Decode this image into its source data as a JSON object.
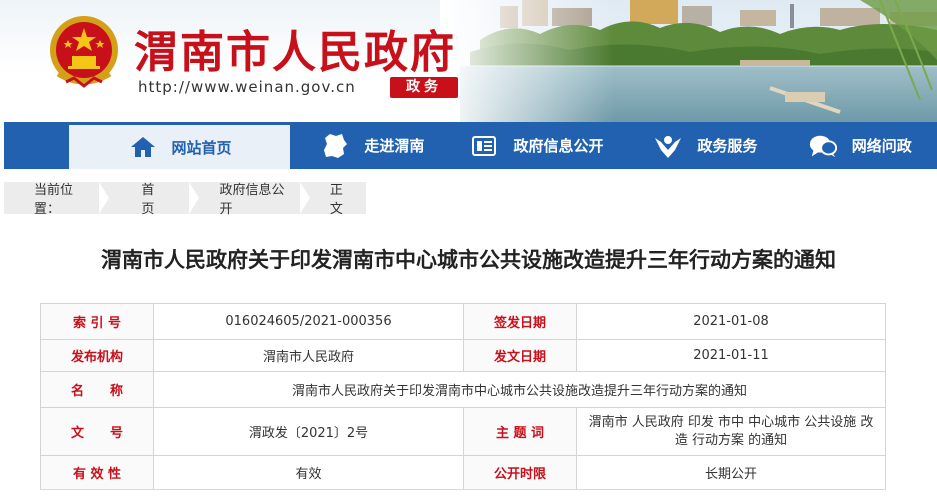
{
  "header": {
    "site_title": "渭南市人民政府",
    "site_url": "http://www.weinan.gov.cn",
    "badge": "政务",
    "brand_color": "#c8101b",
    "emblem_icon": "national-emblem-icon"
  },
  "nav": {
    "color": "#2261b0",
    "items": [
      {
        "label": "网站首页",
        "icon": "home-icon",
        "active": true
      },
      {
        "label": "走进渭南",
        "icon": "map-shape-icon"
      },
      {
        "label": "政府信息公开",
        "icon": "document-icon"
      },
      {
        "label": "政务服务",
        "icon": "service-hands-icon"
      },
      {
        "label": "网络问政",
        "icon": "chat-bubbles-icon"
      }
    ]
  },
  "breadcrumb": {
    "label": "当前位置：",
    "items": [
      "首页",
      "政府信息公开",
      "正文"
    ]
  },
  "article": {
    "title": "渭南市人民政府关于印发渭南市中心城市公共设施改造提升三年行动方案的通知"
  },
  "meta": {
    "index_key": "索 引 号",
    "index_value": "016024605/2021-000356",
    "sign_date_key": "签发日期",
    "sign_date_value": "2021-01-08",
    "publisher_key": "发布机构",
    "publisher_value": "渭南市人民政府",
    "issue_date_key": "发文日期",
    "issue_date_value": "2021-01-11",
    "name_key": "名　　称",
    "name_value": "渭南市人民政府关于印发渭南市中心城市公共设施改造提升三年行动方案的通知",
    "doc_no_key": "文　　号",
    "doc_no_value": "渭政发〔2021〕2号",
    "keywords_key": "主 题 词",
    "keywords_value": "渭南市 人民政府 印发 市中 中心城市 公共设施 改造 行动方案 的通知",
    "validity_key": "有 效 性",
    "validity_value": "有效",
    "disclosure_key": "公开时限",
    "disclosure_value": "长期公开"
  }
}
